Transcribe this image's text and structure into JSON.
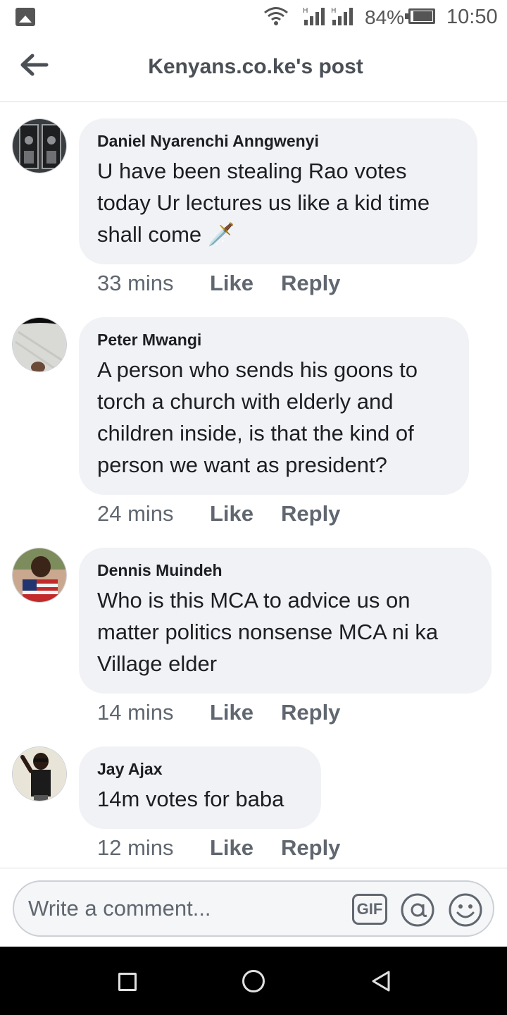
{
  "status_bar": {
    "battery_percent": "84%",
    "time": "10:50",
    "icons": [
      "gallery-icon",
      "wifi-icon",
      "signal-icon",
      "signal-icon",
      "battery-icon"
    ]
  },
  "header": {
    "title": "Kenyans.co.ke's post",
    "back_icon": "arrow-left-icon"
  },
  "comments": [
    {
      "author": "Daniel Nyarenchi Anngwenyi",
      "text": "U have been stealing Rao votes today Ur lectures us like a kid time shall come 🗡️",
      "time": "33 mins",
      "like": "Like",
      "reply": "Reply"
    },
    {
      "author": "Peter Mwangi",
      "text": "A person who sends his goons to torch a church with elderly and children inside, is that the kind of person we want as president?",
      "time": "24 mins",
      "like": "Like",
      "reply": "Reply"
    },
    {
      "author": "Dennis Muindeh",
      "text": "Who is this MCA to advice us on matter politics nonsense MCA ni ka Village elder",
      "time": "14 mins",
      "like": "Like",
      "reply": "Reply"
    },
    {
      "author": "Jay Ajax",
      "text": "14m votes for baba",
      "time": "12 mins",
      "like": "Like",
      "reply": "Reply"
    }
  ],
  "compose": {
    "placeholder": "Write a comment...",
    "gif_label": "GIF"
  },
  "navbar": {
    "icons": [
      "recents-icon",
      "home-icon",
      "back-icon"
    ]
  },
  "colors": {
    "bubble": "#f0f2f5",
    "secondary_text": "#606770",
    "navbar": "#000000"
  }
}
